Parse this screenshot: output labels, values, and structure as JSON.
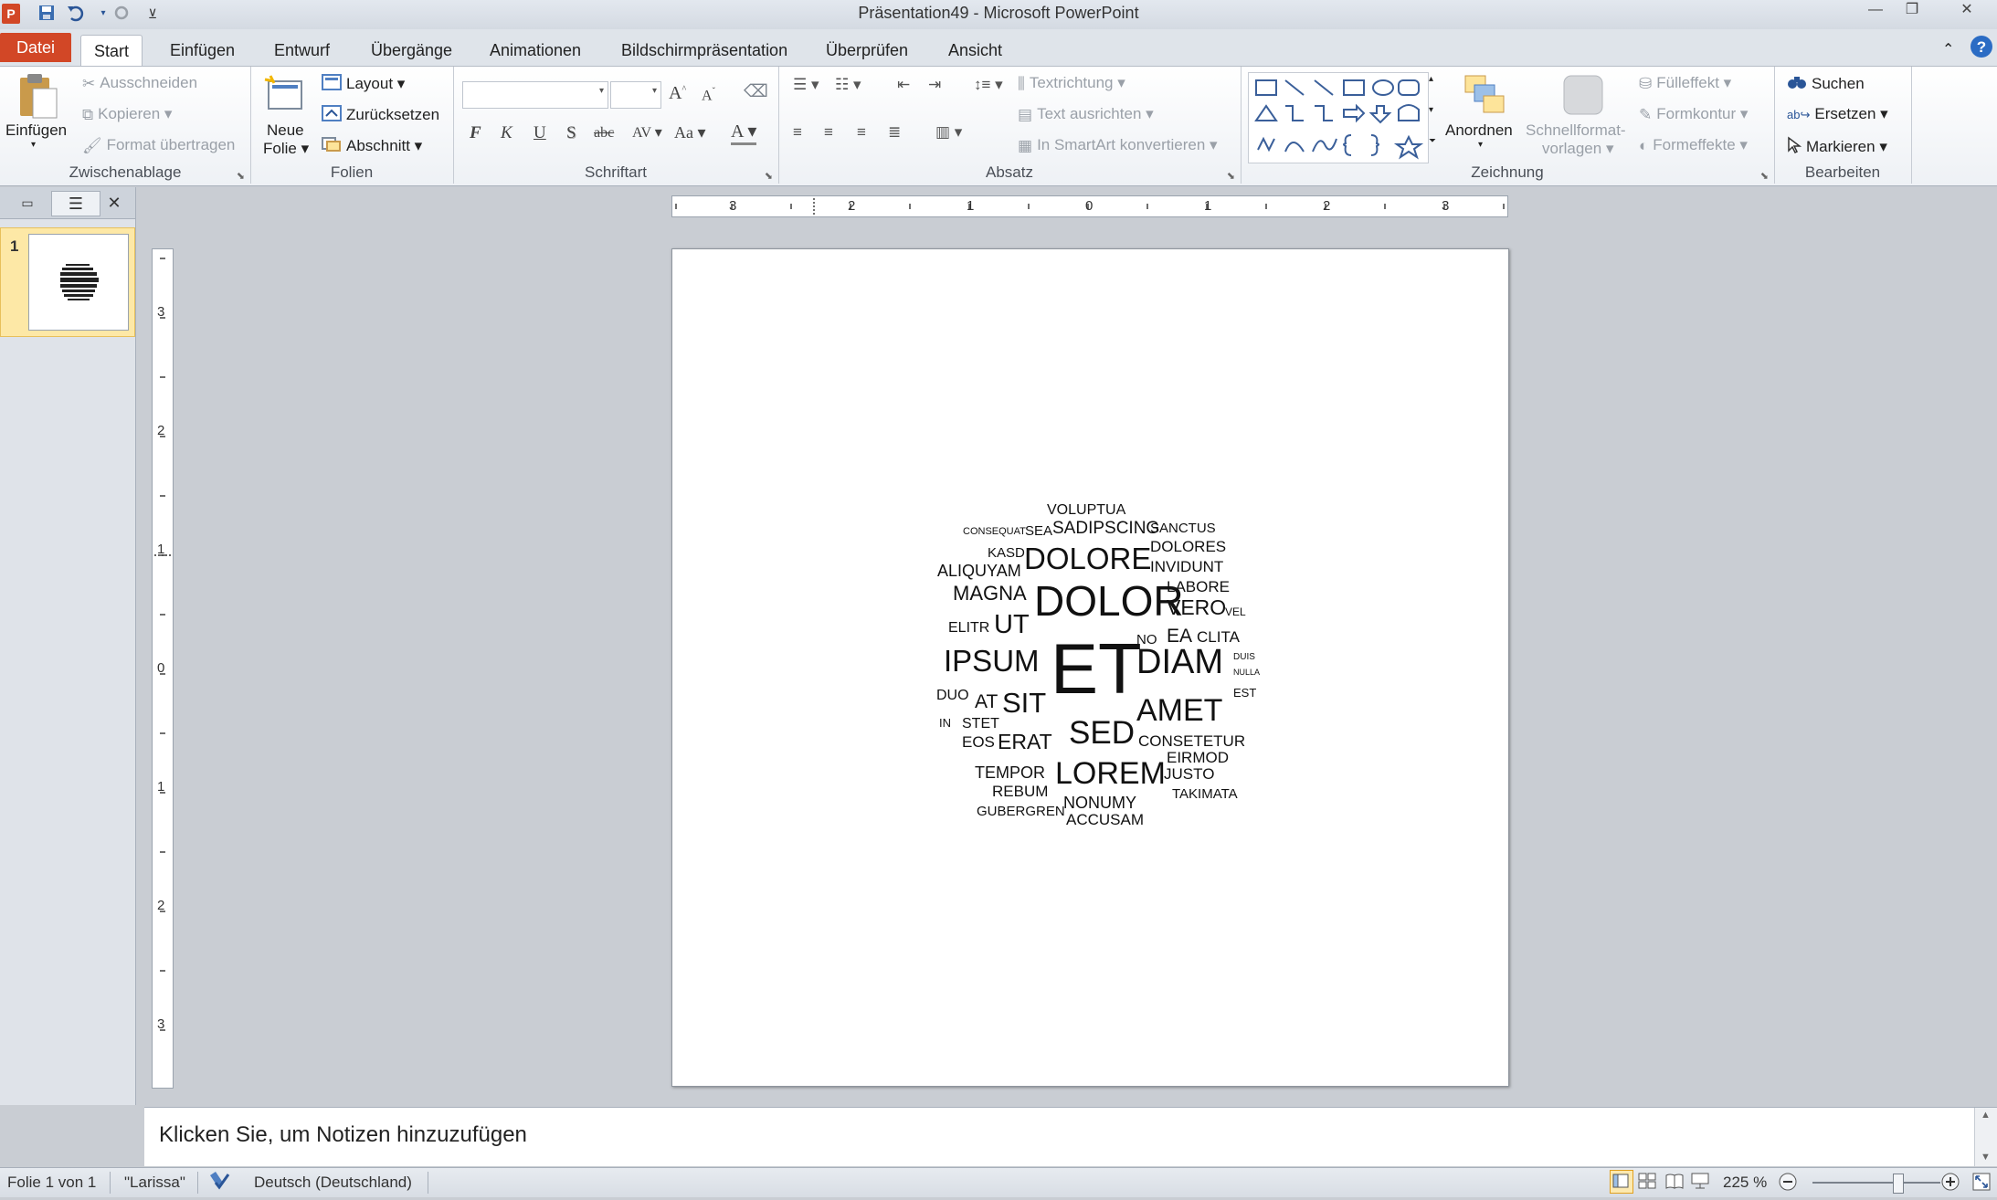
{
  "window": {
    "title": "Präsentation49  -  Microsoft PowerPoint",
    "app_icon": "P",
    "controls": [
      "minimize",
      "restore",
      "close"
    ]
  },
  "quick_access": [
    "save-icon",
    "undo-icon",
    "redo-icon",
    "customize-icon"
  ],
  "tabs": [
    {
      "label": "Datei"
    },
    {
      "label": "Start"
    },
    {
      "label": "Einfügen"
    },
    {
      "label": "Entwurf"
    },
    {
      "label": "Übergänge"
    },
    {
      "label": "Animationen"
    },
    {
      "label": "Bildschirmpräsentation"
    },
    {
      "label": "Überprüfen"
    },
    {
      "label": "Ansicht"
    }
  ],
  "ribbon": {
    "clipboard": {
      "label": "Zwischenablage",
      "paste": "Einfügen",
      "cut": "Ausschneiden",
      "copy": "Kopieren",
      "format_painter": "Format übertragen"
    },
    "slides": {
      "label": "Folien",
      "new_slide_1": "Neue",
      "new_slide_2": "Folie",
      "layout": "Layout",
      "reset": "Zurücksetzen",
      "section": "Abschnitt"
    },
    "font": {
      "label": "Schriftart",
      "font_name": "",
      "font_size": "",
      "bold": "F",
      "italic": "K",
      "underline": "U",
      "shadow": "S",
      "strike": "abc",
      "spacing": "AV",
      "case": "Aa",
      "grow": "A",
      "shrink": "A",
      "color": "A"
    },
    "paragraph": {
      "label": "Absatz",
      "text_direction": "Textrichtung",
      "align_text": "Text ausrichten",
      "smartart": "In SmartArt konvertieren"
    },
    "drawing": {
      "label": "Zeichnung",
      "arrange": "Anordnen",
      "quick_styles_1": "Schnellformat-",
      "quick_styles_2": "vorlagen",
      "fill": "Fülleffekt",
      "outline": "Formkontur",
      "effects": "Formeffekte"
    },
    "editing": {
      "label": "Bearbeiten",
      "find": "Suchen",
      "replace": "Ersetzen",
      "select": "Markieren"
    }
  },
  "slide_pane": {
    "slide_number": "1"
  },
  "hruler_labels": [
    "3",
    "2",
    "1",
    "0",
    "1",
    "2",
    "3"
  ],
  "vruler_labels": [
    "3",
    "2",
    "1",
    "0",
    "1",
    "2",
    "3"
  ],
  "word_cloud": [
    {
      "text": "VOLUPTUA"
    },
    {
      "text": "CONSEQUAT"
    },
    {
      "text": "SEA"
    },
    {
      "text": "SADIPSCING"
    },
    {
      "text": "SANCTUS"
    },
    {
      "text": "KASD"
    },
    {
      "text": "DOLORE"
    },
    {
      "text": "DOLORES"
    },
    {
      "text": "ALIQUYAM"
    },
    {
      "text": "INVIDUNT"
    },
    {
      "text": "MAGNA"
    },
    {
      "text": "DOLOR"
    },
    {
      "text": "LABORE"
    },
    {
      "text": "VERO"
    },
    {
      "text": "VEL"
    },
    {
      "text": "ELITR"
    },
    {
      "text": "UT"
    },
    {
      "text": "NO"
    },
    {
      "text": "EA"
    },
    {
      "text": "CLITA"
    },
    {
      "text": "IPSUM"
    },
    {
      "text": "ET"
    },
    {
      "text": "DIAM"
    },
    {
      "text": "DUIS"
    },
    {
      "text": "NULLA"
    },
    {
      "text": "EST"
    },
    {
      "text": "DUO"
    },
    {
      "text": "AT"
    },
    {
      "text": "SIT"
    },
    {
      "text": "AMET"
    },
    {
      "text": "IN"
    },
    {
      "text": "STET"
    },
    {
      "text": "SED"
    },
    {
      "text": "CONSETETUR"
    },
    {
      "text": "EOS"
    },
    {
      "text": "ERAT"
    },
    {
      "text": "EIRMOD"
    },
    {
      "text": "TEMPOR"
    },
    {
      "text": "LOREM"
    },
    {
      "text": "JUSTO"
    },
    {
      "text": "REBUM"
    },
    {
      "text": "TAKIMATA"
    },
    {
      "text": "NONUMY"
    },
    {
      "text": "GUBERGREN"
    },
    {
      "text": "ACCUSAM"
    }
  ],
  "notes": {
    "placeholder": "Klicken Sie, um Notizen hinzuzufügen"
  },
  "status": {
    "slide_info": "Folie 1 von 1",
    "theme": "\"Larissa\"",
    "language": "Deutsch (Deutschland)",
    "zoom": "225 %",
    "zoom_level_percent": 225
  }
}
